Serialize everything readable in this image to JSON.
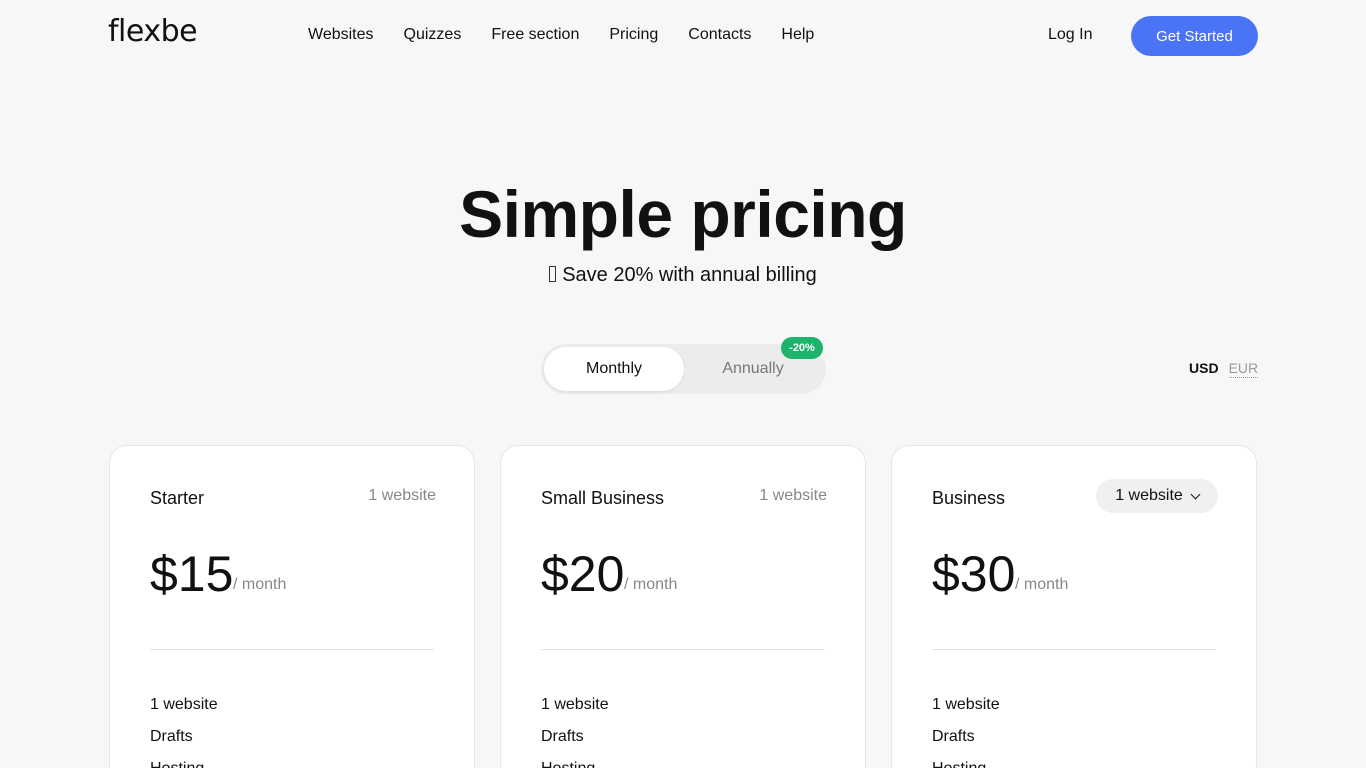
{
  "header": {
    "logo": "flexbe",
    "nav": [
      "Websites",
      "Quizzes",
      "Free section",
      "Pricing",
      "Contacts",
      "Help"
    ],
    "login": "Log In",
    "cta": "Get Started"
  },
  "hero": {
    "title": "Simple pricing",
    "subtitle": "Save 20% with annual billing",
    "subtitle_icon": "gift-icon"
  },
  "billing": {
    "monthly": "Monthly",
    "annually": "Annually",
    "annual_badge": "-20%",
    "selected": "Monthly"
  },
  "currency": {
    "usd": "USD",
    "eur": "EUR",
    "selected": "USD"
  },
  "colors": {
    "accent": "#4a73f5",
    "badge": "#1cb36b"
  },
  "plans": [
    {
      "name": "Starter",
      "sites": "1 website",
      "price": "$15",
      "per": "/ month",
      "features": [
        "1 website",
        "Drafts",
        "Hosting"
      ]
    },
    {
      "name": "Small Business",
      "sites": "1 website",
      "price": "$20",
      "per": "/ month",
      "features": [
        "1 website",
        "Drafts",
        "Hosting"
      ]
    },
    {
      "name": "Business",
      "sites": "1 website",
      "price": "$30",
      "per": "/ month",
      "features": [
        "1 website",
        "Drafts",
        "Hosting"
      ]
    }
  ]
}
